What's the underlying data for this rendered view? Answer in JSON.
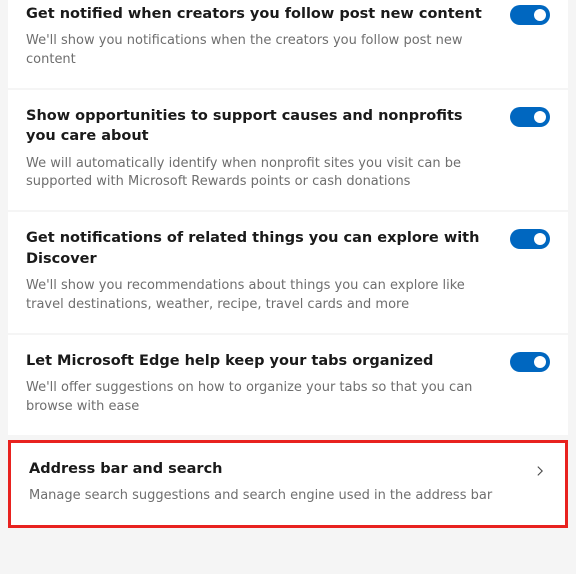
{
  "settings": [
    {
      "title": "Get notified when creators you follow post new content",
      "description": "We'll show you notifications when the creators you follow post new content"
    },
    {
      "title": "Show opportunities to support causes and nonprofits you care about",
      "description": "We will automatically identify when nonprofit sites you visit can be supported with Microsoft Rewards points or cash donations"
    },
    {
      "title": "Get notifications of related things you can explore with Discover",
      "description": "We'll show you recommendations about things you can explore like travel destinations, weather, recipe, travel cards and more"
    },
    {
      "title": "Let Microsoft Edge help keep your tabs organized",
      "description": "We'll offer suggestions on how to organize your tabs so that you can browse with ease"
    }
  ],
  "nav": {
    "title": "Address bar and search",
    "description": "Manage search suggestions and search engine used in the address bar"
  }
}
